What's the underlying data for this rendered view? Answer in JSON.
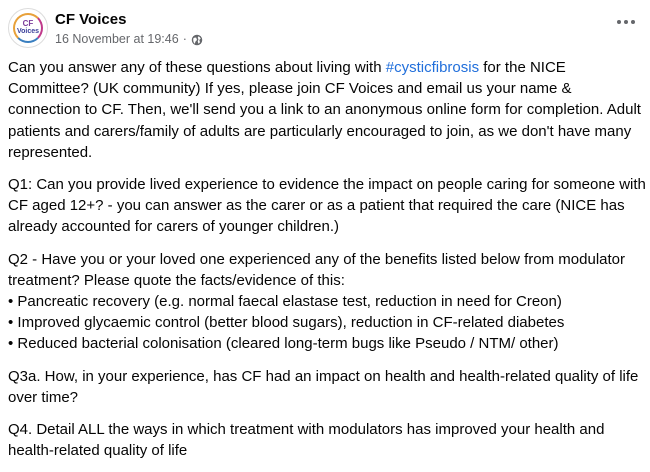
{
  "post": {
    "page_name": "CF Voices",
    "avatar_line1": "CF",
    "avatar_line2": "Voices",
    "timestamp": "16 November at 19:46",
    "separator": "·",
    "privacy_icon": "globe-icon",
    "more_icon": "more-options-icon",
    "p1_before": "Can you answer any of these questions about living with ",
    "hashtag": "#cysticfibrosis",
    "p1_after": " for the NICE Committee? (UK community) If yes, please join CF Voices and email us your name & connection to CF. Then, we'll send you a link to an anonymous online form for completion. Adult patients and carers/family of adults are particularly encouraged to join, as we don't have many represented.",
    "q1": "Q1: Can you provide lived experience to evidence the impact on people caring for someone with CF aged 12+? - you can answer as the carer or as a patient that required the care (NICE has already accounted for carers of younger children.)",
    "q2_intro": "Q2 - Have you or your loved one experienced any of the benefits listed below from modulator treatment? Please quote the facts/evidence of this:",
    "q2_bullets": [
      "• Pancreatic recovery (e.g. normal faecal elastase test, reduction in need for Creon)",
      "• Improved glycaemic control (better blood sugars), reduction in CF-related diabetes",
      "• Reduced bacterial colonisation (cleared long-term bugs like Pseudo / NTM/ other)"
    ],
    "q3a": "Q3a. How, in your experience, has CF had an impact on health and health-related quality of life over time?",
    "q4": "Q4. Detail ALL the ways in which treatment with modulators has improved your health and health-related quality of life"
  },
  "colors": {
    "text": "#050505",
    "secondary": "#65676b",
    "link": "#216fdb"
  }
}
